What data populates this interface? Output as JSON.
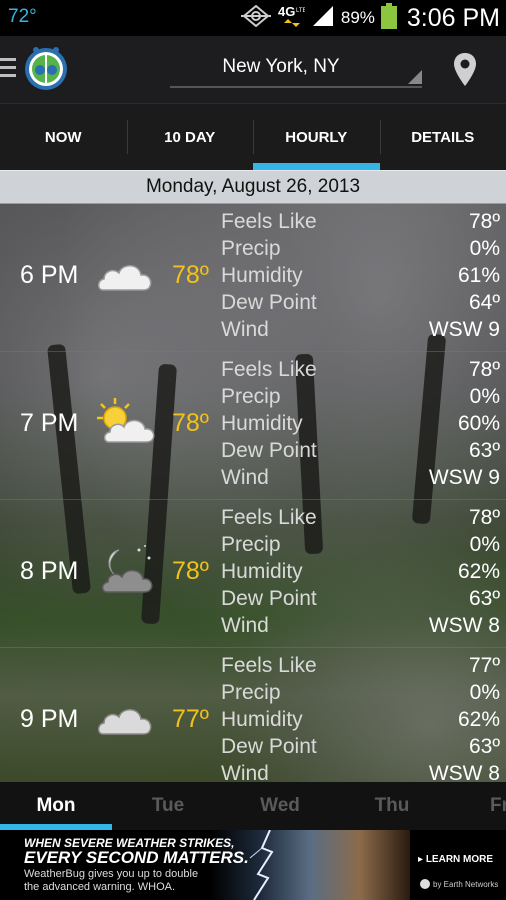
{
  "status_bar": {
    "temperature": "72°",
    "network": "4G",
    "battery_percent": "89%",
    "time": "3:06 PM",
    "icons": [
      "gps-icon",
      "network-4g-icon",
      "signal-icon",
      "battery-icon"
    ]
  },
  "app_bar": {
    "location": "New York, NY",
    "icons": [
      "menu-icon",
      "weatherbug-logo",
      "location-pin-icon"
    ]
  },
  "tabs": [
    {
      "label": "NOW",
      "active": false
    },
    {
      "label": "10 DAY",
      "active": false
    },
    {
      "label": "HOURLY",
      "active": true
    },
    {
      "label": "DETAILS",
      "active": false
    }
  ],
  "date_header": "Monday, August 26, 2013",
  "hours": [
    {
      "time": "6 PM",
      "temp": "78º",
      "icon": "cloudy-icon",
      "details": [
        {
          "label": "Feels Like",
          "value": "78º"
        },
        {
          "label": "Precip",
          "value": "0%"
        },
        {
          "label": "Humidity",
          "value": "61%"
        },
        {
          "label": "Dew Point",
          "value": "64º"
        },
        {
          "label": "Wind",
          "value": "WSW 9"
        }
      ]
    },
    {
      "time": "7 PM",
      "temp": "78º",
      "icon": "partly-sunny-icon",
      "details": [
        {
          "label": "Feels Like",
          "value": "78º"
        },
        {
          "label": "Precip",
          "value": "0%"
        },
        {
          "label": "Humidity",
          "value": "60%"
        },
        {
          "label": "Dew Point",
          "value": "63º"
        },
        {
          "label": "Wind",
          "value": "WSW 9"
        }
      ]
    },
    {
      "time": "8 PM",
      "temp": "78º",
      "icon": "partly-cloudy-night-icon",
      "details": [
        {
          "label": "Feels Like",
          "value": "78º"
        },
        {
          "label": "Precip",
          "value": "0%"
        },
        {
          "label": "Humidity",
          "value": "62%"
        },
        {
          "label": "Dew Point",
          "value": "63º"
        },
        {
          "label": "Wind",
          "value": "WSW 8"
        }
      ]
    },
    {
      "time": "9 PM",
      "temp": "77º",
      "icon": "cloudy-icon",
      "details": [
        {
          "label": "Feels Like",
          "value": "77º"
        },
        {
          "label": "Precip",
          "value": "0%"
        },
        {
          "label": "Humidity",
          "value": "62%"
        },
        {
          "label": "Dew Point",
          "value": "63º"
        },
        {
          "label": "Wind",
          "value": "WSW 8"
        }
      ]
    }
  ],
  "day_tabs": [
    {
      "label": "Mon",
      "active": true
    },
    {
      "label": "Tue",
      "active": false
    },
    {
      "label": "Wed",
      "active": false
    },
    {
      "label": "Thu",
      "active": false
    },
    {
      "label": "Fri",
      "active": false
    }
  ],
  "ad": {
    "headline_1": "WHEN SEVERE WEATHER STRIKES,",
    "headline_2": "EVERY SECOND MATTERS.",
    "sub_1": "WeatherBug gives you up to double",
    "sub_2": "the advanced warning. WHOA.",
    "cta": "LEARN MORE",
    "by": "by Earth Networks"
  },
  "colors": {
    "accent": "#33b5e5",
    "temp": "#f2c21b"
  }
}
